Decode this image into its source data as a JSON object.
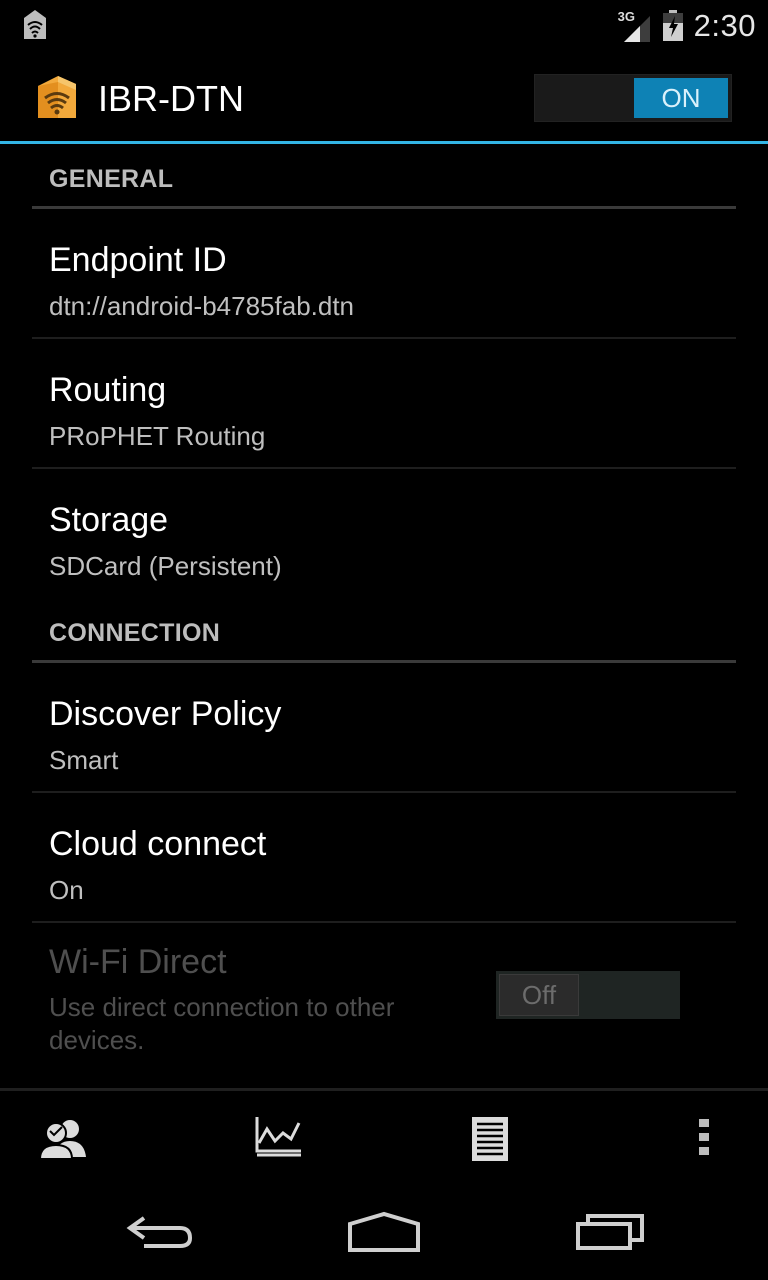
{
  "status_bar": {
    "time": "2:30",
    "network_label": "3G",
    "left_icon": "ibr-dtn-notification-icon"
  },
  "action_bar": {
    "title": "IBR-DTN",
    "toggle_label": "ON",
    "toggle_state": "on",
    "accent_color": "#33b5e5"
  },
  "sections": [
    {
      "header": "GENERAL",
      "items": [
        {
          "title": "Endpoint ID",
          "summary": "dtn://android-b4785fab.dtn"
        },
        {
          "title": "Routing",
          "summary": "PRoPHET Routing"
        },
        {
          "title": "Storage",
          "summary": "SDCard (Persistent)"
        }
      ]
    },
    {
      "header": "CONNECTION",
      "items": [
        {
          "title": "Discover Policy",
          "summary": "Smart"
        },
        {
          "title": "Cloud connect",
          "summary": "On"
        },
        {
          "title": "Wi-Fi Direct",
          "summary": "Use direct connection to other devices.",
          "toggle_label": "Off",
          "enabled": false
        }
      ]
    }
  ],
  "bottom_bar": {
    "icons": [
      "neighbors-icon",
      "statistics-chart-icon",
      "log-list-icon",
      "overflow-menu-icon"
    ]
  },
  "nav_bar": {
    "icons": [
      "back-icon",
      "home-icon",
      "recent-apps-icon"
    ]
  }
}
